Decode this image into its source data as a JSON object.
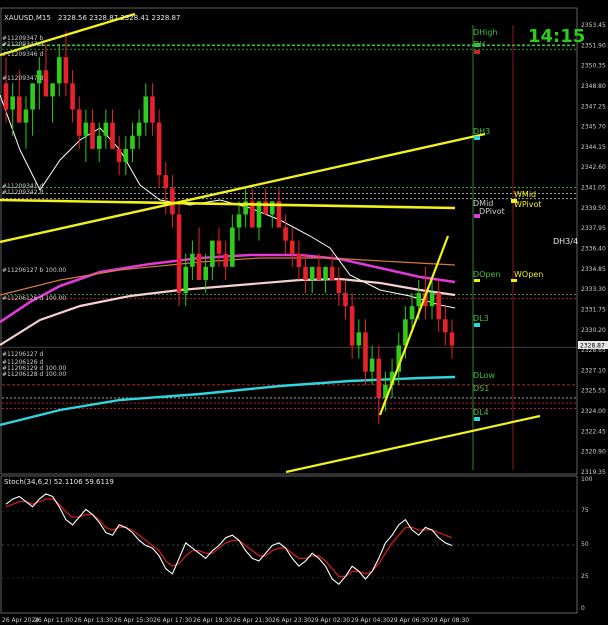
{
  "header": {
    "symbol": "XAUUSD,M15",
    "ohlc": "2328.56 2328.87 2328.41 2328.87",
    "clock": "14:15",
    "osc_title": "Stoch(34,6,2) 52.1106 59.6119"
  },
  "left_notes": {
    "top": [
      "#11209347 b",
      "#11209347 d",
      "#11209346 d"
    ],
    "mid1": [
      "#11209347 d",
      "#11209346 d",
      "#11209345 d"
    ],
    "mid2": [
      "#11209341 d",
      "#11209342 d"
    ],
    "lower": [
      "#11206127 b 100.00",
      "#11206126 d 100.00"
    ],
    "bottom": [
      "#11206127 d",
      "#11206126 d",
      "#11206129 d 100.00",
      "#11206128 d 100.00"
    ]
  },
  "pivot_labels": {
    "dhigh": "DHigh",
    "dh": "DH",
    "dh3": "DH3",
    "dmid": "DMid",
    "dpivot": "DPivot",
    "wmid": "WMid",
    "wpivot": "WPivot",
    "dh34": "DH3/4",
    "dopen": "DOpen",
    "wopen": "WOpen",
    "dl3": "DL3",
    "dlow": "DLow",
    "ds1": "DS1",
    "dl4": "DL4"
  },
  "price_axis": [
    "2353.45",
    "2351.90",
    "2350.35",
    "2348.80",
    "2347.25",
    "2345.70",
    "2344.15",
    "2342.60",
    "2341.05",
    "2339.50",
    "2337.95",
    "2336.40",
    "2334.85",
    "2333.30",
    "2331.75",
    "2330.20",
    "2328.65",
    "2327.10",
    "2325.55",
    "2324.00",
    "2322.45",
    "2320.90",
    "2319.35"
  ],
  "current_price_tag": "2328.87",
  "osc_axis": [
    "100",
    "75",
    "50",
    "25",
    "0"
  ],
  "time_axis": [
    "26 Apr 2024",
    "26 Apr 11:00",
    "26 Apr 13:30",
    "26 Apr 15:30",
    "26 Apr 17:30",
    "26 Apr 19:30",
    "26 Apr 21:30",
    "26 Apr 23:30",
    "29 Apr 02:30",
    "29 Apr 04:30",
    "29 Apr 06:30",
    "29 Apr 08:30"
  ],
  "colors": {
    "bull": "#2ecc1b",
    "bear": "#e8222a",
    "trend": "#f2f21a",
    "ma_magenta": "#e23ad8",
    "ma_cyan": "#2fd5df",
    "ma_pink": "#f5d0d0",
    "ma_orange": "#d27a3c",
    "level_green": "#3fbf3f",
    "level_red": "#c62828"
  },
  "candles": [
    [
      2349,
      2351,
      2346,
      2347
    ],
    [
      2347,
      2349,
      2345,
      2348
    ],
    [
      2348,
      2350,
      2346,
      2346
    ],
    [
      2346,
      2348,
      2344,
      2347
    ],
    [
      2347,
      2349,
      2345,
      2349
    ],
    [
      2349,
      2351,
      2347,
      2350
    ],
    [
      2350,
      2352,
      2348,
      2348
    ],
    [
      2348,
      2349,
      2346,
      2349
    ],
    [
      2349,
      2352,
      2348,
      2351
    ],
    [
      2351,
      2353,
      2348,
      2349
    ],
    [
      2349,
      2350,
      2346,
      2347
    ],
    [
      2347,
      2348,
      2344,
      2345
    ],
    [
      2345,
      2347,
      2343,
      2346
    ],
    [
      2346,
      2347,
      2344,
      2344
    ],
    [
      2344,
      2346,
      2343,
      2345
    ],
    [
      2345,
      2347,
      2344,
      2346
    ],
    [
      2346,
      2347,
      2344,
      2344
    ],
    [
      2344,
      2345,
      2342,
      2343
    ],
    [
      2343,
      2345,
      2342,
      2344
    ],
    [
      2344,
      2346,
      2343,
      2345
    ],
    [
      2345,
      2347,
      2344,
      2346
    ],
    [
      2346,
      2349,
      2345,
      2348
    ],
    [
      2348,
      2349,
      2345,
      2346
    ],
    [
      2346,
      2347,
      2341,
      2342
    ],
    [
      2342,
      2343,
      2339,
      2341
    ],
    [
      2341,
      2342,
      2338,
      2339
    ],
    [
      2339,
      2340,
      2332,
      2333
    ],
    [
      2333,
      2336,
      2332,
      2335
    ],
    [
      2335,
      2337,
      2334,
      2336
    ],
    [
      2336,
      2338,
      2334,
      2334
    ],
    [
      2334,
      2336,
      2333,
      2335
    ],
    [
      2335,
      2337,
      2334,
      2337
    ],
    [
      2337,
      2338,
      2335,
      2336
    ],
    [
      2336,
      2337,
      2334,
      2335
    ],
    [
      2335,
      2339,
      2335,
      2338
    ],
    [
      2338,
      2340,
      2337,
      2339
    ],
    [
      2339,
      2341,
      2338,
      2340
    ],
    [
      2340,
      2341,
      2338,
      2338
    ],
    [
      2338,
      2340,
      2337,
      2340
    ],
    [
      2340,
      2341,
      2339,
      2339
    ],
    [
      2339,
      2340,
      2338,
      2340
    ],
    [
      2340,
      2341,
      2338,
      2338
    ],
    [
      2338,
      2339,
      2336,
      2337
    ],
    [
      2337,
      2338,
      2335,
      2336
    ],
    [
      2336,
      2337,
      2334,
      2335
    ],
    [
      2335,
      2336,
      2333,
      2334
    ],
    [
      2334,
      2335,
      2333,
      2335
    ],
    [
      2335,
      2336,
      2334,
      2334
    ],
    [
      2334,
      2335,
      2333,
      2335
    ],
    [
      2335,
      2336,
      2334,
      2334
    ],
    [
      2334,
      2335,
      2332,
      2333
    ],
    [
      2333,
      2334,
      2331,
      2332
    ],
    [
      2332,
      2333,
      2328,
      2329
    ],
    [
      2329,
      2331,
      2328,
      2330
    ],
    [
      2330,
      2331,
      2326,
      2327
    ],
    [
      2327,
      2329,
      2326,
      2328
    ],
    [
      2328,
      2329,
      2323,
      2325
    ],
    [
      2325,
      2327,
      2324,
      2326
    ],
    [
      2326,
      2328,
      2325,
      2327
    ],
    [
      2327,
      2330,
      2326,
      2329
    ],
    [
      2329,
      2332,
      2328,
      2331
    ],
    [
      2331,
      2333,
      2330,
      2332
    ],
    [
      2332,
      2334,
      2331,
      2333
    ],
    [
      2333,
      2335,
      2331,
      2332
    ],
    [
      2332,
      2334,
      2331,
      2333
    ],
    [
      2333,
      2334,
      2330,
      2331
    ],
    [
      2331,
      2332,
      2329,
      2330
    ],
    [
      2330,
      2331,
      2328,
      2329
    ]
  ],
  "osc_main": [
    82,
    86,
    88,
    84,
    80,
    86,
    90,
    88,
    80,
    70,
    66,
    72,
    78,
    74,
    68,
    60,
    58,
    66,
    64,
    60,
    54,
    50,
    48,
    42,
    32,
    28,
    40,
    52,
    48,
    44,
    40,
    46,
    50,
    56,
    58,
    54,
    46,
    40,
    38,
    44,
    50,
    52,
    48,
    40,
    34,
    38,
    44,
    40,
    34,
    24,
    20,
    26,
    34,
    30,
    24,
    30,
    40,
    52,
    58,
    66,
    70,
    62,
    58,
    64,
    62,
    56,
    52,
    50
  ],
  "osc_signal": [
    80,
    82,
    84,
    84,
    82,
    84,
    86,
    86,
    82,
    76,
    72,
    72,
    74,
    74,
    70,
    64,
    62,
    64,
    64,
    62,
    58,
    54,
    50,
    46,
    38,
    34,
    36,
    42,
    46,
    46,
    44,
    44,
    48,
    52,
    54,
    54,
    50,
    46,
    42,
    42,
    46,
    48,
    48,
    44,
    40,
    40,
    42,
    42,
    38,
    32,
    26,
    26,
    30,
    30,
    28,
    30,
    36,
    44,
    52,
    58,
    64,
    64,
    62,
    62,
    62,
    60,
    58,
    56
  ]
}
